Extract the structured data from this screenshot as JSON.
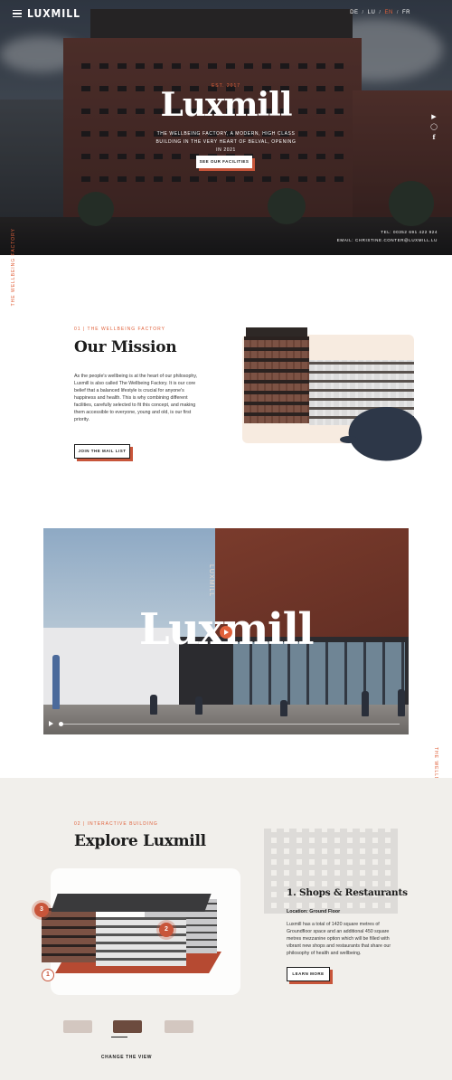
{
  "header": {
    "logo": "LUXMILL",
    "languages": [
      {
        "code": "DE",
        "active": false
      },
      {
        "code": "LU",
        "active": false
      },
      {
        "code": "EN",
        "active": true
      },
      {
        "code": "FR",
        "active": false
      }
    ],
    "lang_sep": "/"
  },
  "hero": {
    "est": "EST. 2017",
    "title": "Luxmill",
    "subtitle": "THE WELLBEING FACTORY, A MODERN, HIGH CLASS BUILDING IN THE VERY HEART OF BELVAL, OPENING IN 2021",
    "cta": "SEE OUR FACILITIES",
    "tel": "TEL: 00352 691 422 924",
    "email": "EMAIL: CHRISTINE.CONTER@LUXMILL.LU",
    "social_icons": [
      "youtube-icon",
      "instagram-icon",
      "facebook-icon"
    ]
  },
  "side_labels": {
    "left": "THE WELLBEING FACTORY",
    "right": "THE WELLBEING FACTORY"
  },
  "mission": {
    "kicker": "01 | THE WELLBEING FACTORY",
    "title": "Our Mission",
    "body": "As the people's wellbeing is at the heart of our philosophy, Luxmill is also called The Wellbeing Factory. It is our core belief that a balanced lifestyle is crucial for anyone's happiness and health. This is why combining different facilities, carefully selected to fit this concept, and making them accessible to everyone, young and old, is our first priority.",
    "cta": "JOIN THE MAIL LIST"
  },
  "video": {
    "title": "Luxmill",
    "sign": "LUXMILL"
  },
  "explore": {
    "kicker": "02 | INTERACTIVE BUILDING",
    "title": "Explore Luxmill",
    "markers": [
      "1",
      "2",
      "3"
    ],
    "section_title": "1. Shops & Restaurants",
    "location": "Location: Ground Floor",
    "body": "Luxmill has a total of 1420 square metres of Groundfloor space and an additional 450 square metres mezzanine option which will be filled with vibrant new shops and restaurants that share our philosophy of health and wellbeing.",
    "cta": "LEARN MORE",
    "change_view": "CHANGE THE VIEW"
  },
  "colors": {
    "accent": "#e0613b",
    "button_shadow": "#c8553a",
    "explore_bg": "#f1efeb"
  }
}
